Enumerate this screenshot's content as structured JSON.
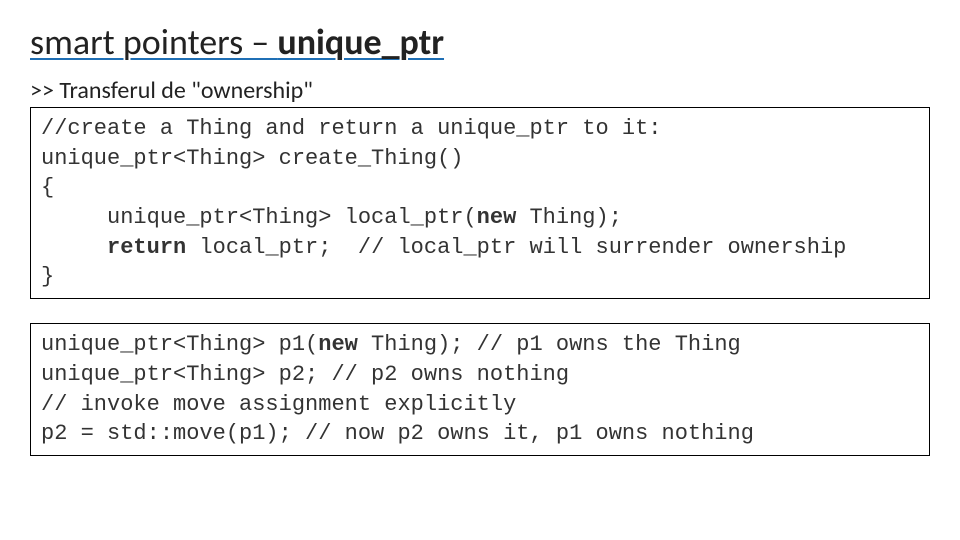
{
  "title": {
    "part1": "smart pointers – ",
    "part2": "unique_ptr"
  },
  "subtitle": ">> Transferul de \"ownership\"",
  "code1": {
    "l1": "//create a Thing and return a unique_ptr to it:",
    "l2": "unique_ptr<Thing> create_Thing()",
    "l3": "{",
    "l4a": "     unique_ptr<Thing> local_ptr(",
    "l4kw": "new",
    "l4b": " Thing);",
    "l5a": "     ",
    "l5kw": "return",
    "l5b": " local_ptr;  // local_ptr will surrender ownership",
    "l6": "}"
  },
  "code2": {
    "l1a": "unique_ptr<Thing> p1(",
    "l1kw": "new",
    "l1b": " Thing); // p1 owns the Thing",
    "l2": "unique_ptr<Thing> p2; // p2 owns nothing",
    "l3": "// invoke move assignment explicitly",
    "l4": "p2 = std::move(p1); // now p2 owns it, p1 owns nothing"
  }
}
